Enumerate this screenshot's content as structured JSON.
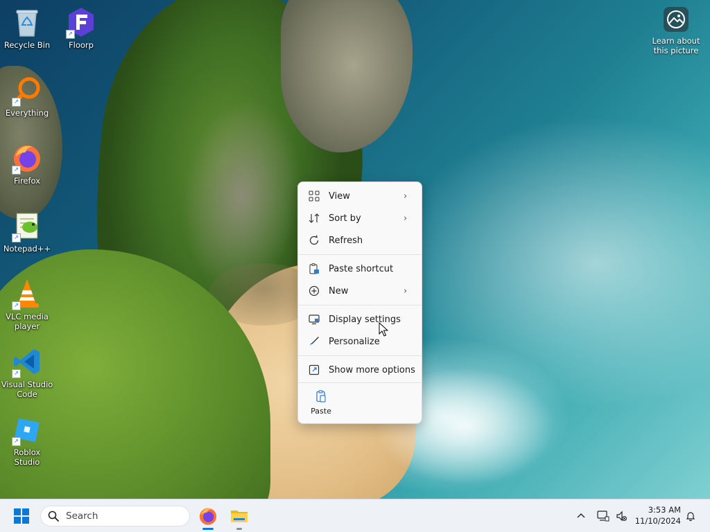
{
  "desktop": {
    "icons": [
      {
        "label": "Recycle Bin"
      },
      {
        "label": "Floorp"
      },
      {
        "label": "Everything"
      },
      {
        "label": "Firefox"
      },
      {
        "label": "Notepad++"
      },
      {
        "label": "VLC media player"
      },
      {
        "label": "Visual Studio Code"
      },
      {
        "label": "Roblox Studio"
      }
    ],
    "learn_about_picture": "Learn about this picture"
  },
  "context_menu": {
    "items": [
      {
        "label": "View",
        "icon": "grid-icon",
        "submenu": true
      },
      {
        "label": "Sort by",
        "icon": "sort-icon",
        "submenu": true
      },
      {
        "label": "Refresh",
        "icon": "refresh-icon",
        "submenu": false
      },
      {
        "label": "Paste shortcut",
        "icon": "paste-shortcut-icon",
        "submenu": false
      },
      {
        "label": "New",
        "icon": "plus-circle-icon",
        "submenu": true
      },
      {
        "label": "Display settings",
        "icon": "display-icon",
        "submenu": false
      },
      {
        "label": "Personalize",
        "icon": "brush-icon",
        "submenu": false
      },
      {
        "label": "Show more options",
        "icon": "expand-icon",
        "submenu": false
      }
    ],
    "paste_label": "Paste",
    "accent": "#0067c0"
  },
  "taskbar": {
    "search_placeholder": "Search",
    "time": "3:53 AM",
    "date": "11/10/2024",
    "apps": [
      "Firefox",
      "File Explorer"
    ]
  }
}
